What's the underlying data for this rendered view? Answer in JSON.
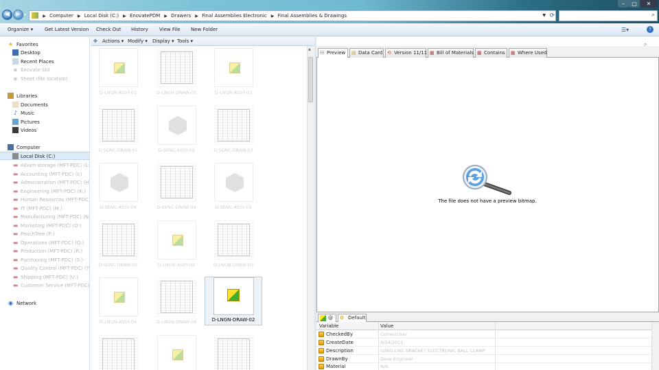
{
  "window": {
    "controls": [
      "–",
      "▢",
      "✕"
    ]
  },
  "address": {
    "crumbs": [
      "Computer",
      "Local Disk (C:)",
      "EnovatePDM",
      "Drawers",
      "Final Assemblies Electronic",
      "Final Assemblies & Drawings"
    ]
  },
  "search": {
    "placeholder": ""
  },
  "commandbar": {
    "items": [
      "Organize ▾",
      "Get Latest Version",
      "Check Out",
      "History",
      "View File",
      "New Folder"
    ]
  },
  "nav": {
    "favorites": "Favorites",
    "favorite_items": [
      "Desktop",
      "Recent Places",
      "Enovate Std",
      "Sheet (file location)"
    ],
    "libraries": "Libraries",
    "library_items": [
      "Documents",
      "Music",
      "Pictures",
      "Videos"
    ],
    "computer": "Computer",
    "selected_drive": "Local Disk (C:)",
    "drives": [
      "Album storage (MFT-PDC) (L:)",
      "Accounting (MFT-PDC) (I:)",
      "Administration (MFT-PDC) (H:)",
      "Engineering (MFT-PDC) (K:)",
      "Human Resources (MFT-PDC)",
      "IT (MFT-PDC) (M:)",
      "Manufacturing (MFT-PDC) (N:)",
      "Marketing (MFT-PDC) (O:)",
      "PeachTree (P:)",
      "Operations (MFT-PDC) (Q:)",
      "Production (MFT-PDC) (R:)",
      "Purchasing (MFT-PDC) (S:)",
      "Quality Control (MFT-PDC) (T:)",
      "Shipping (MFT-PDC) (U:)",
      "Customer Service (MFT-PDC) (V:)"
    ],
    "network": "Network"
  },
  "middle_toolbar": {
    "items": [
      "Actions ▾",
      "Modify ▾",
      "Display ▾",
      "Tools ▾"
    ]
  },
  "files": [
    {
      "kind": "part",
      "caption": "D-LNGN-ASSY-01"
    },
    {
      "kind": "drawing",
      "caption": "D-LNGN-DRAW-01"
    },
    {
      "kind": "part",
      "caption": "D-LNGN-ASSY-03"
    },
    {
      "kind": "drawing",
      "caption": "D-SENC-DRAW-01"
    },
    {
      "kind": "hex",
      "caption": "D-SENC-ASSY-02"
    },
    {
      "kind": "drawing",
      "caption": "D-SENC-DRAW-03"
    },
    {
      "kind": "hex",
      "caption": "D-SENC-ASSY-04"
    },
    {
      "kind": "drawing",
      "caption": "D-SENC-DRAW-04"
    },
    {
      "kind": "hex",
      "caption": "D-SENC-ASSY-05"
    },
    {
      "kind": "drawing",
      "caption": "D-SENC-DRAW-05"
    },
    {
      "kind": "part",
      "caption": "D-LNGN-ASSY-02"
    },
    {
      "kind": "drawing",
      "caption": "D-LNGN-DRAW-03"
    },
    {
      "kind": "part",
      "caption": "D-LNGN-ASSY-04"
    },
    {
      "kind": "drawing",
      "caption": "D-LNGN-DRAW-04"
    },
    {
      "kind": "selected",
      "caption": "D-LNGN-DRAW-02"
    },
    {
      "kind": "drawing",
      "caption": ""
    },
    {
      "kind": "part",
      "caption": ""
    },
    {
      "kind": "drawing",
      "caption": ""
    }
  ],
  "tabs": [
    "Preview",
    "Data Card",
    "Version 11/11",
    "Bill of Materials",
    "Contains",
    "Where Used"
  ],
  "preview": {
    "message": "The file does not have a preview bitmap."
  },
  "variable_tabs": [
    "@",
    "Default"
  ],
  "variables": {
    "col_variable": "Variable",
    "col_value": "Value",
    "rows": [
      {
        "name": "CheckedBy",
        "value": "CurrentUser"
      },
      {
        "name": "CreateDate",
        "value": "9/24/2011"
      },
      {
        "name": "Description",
        "value": "LONG LINE BRACKET ELECTRONIC BALL CLAMP"
      },
      {
        "name": "DrawnBy",
        "value": "Dave Engineer"
      },
      {
        "name": "Material",
        "value": "N/A"
      }
    ]
  }
}
